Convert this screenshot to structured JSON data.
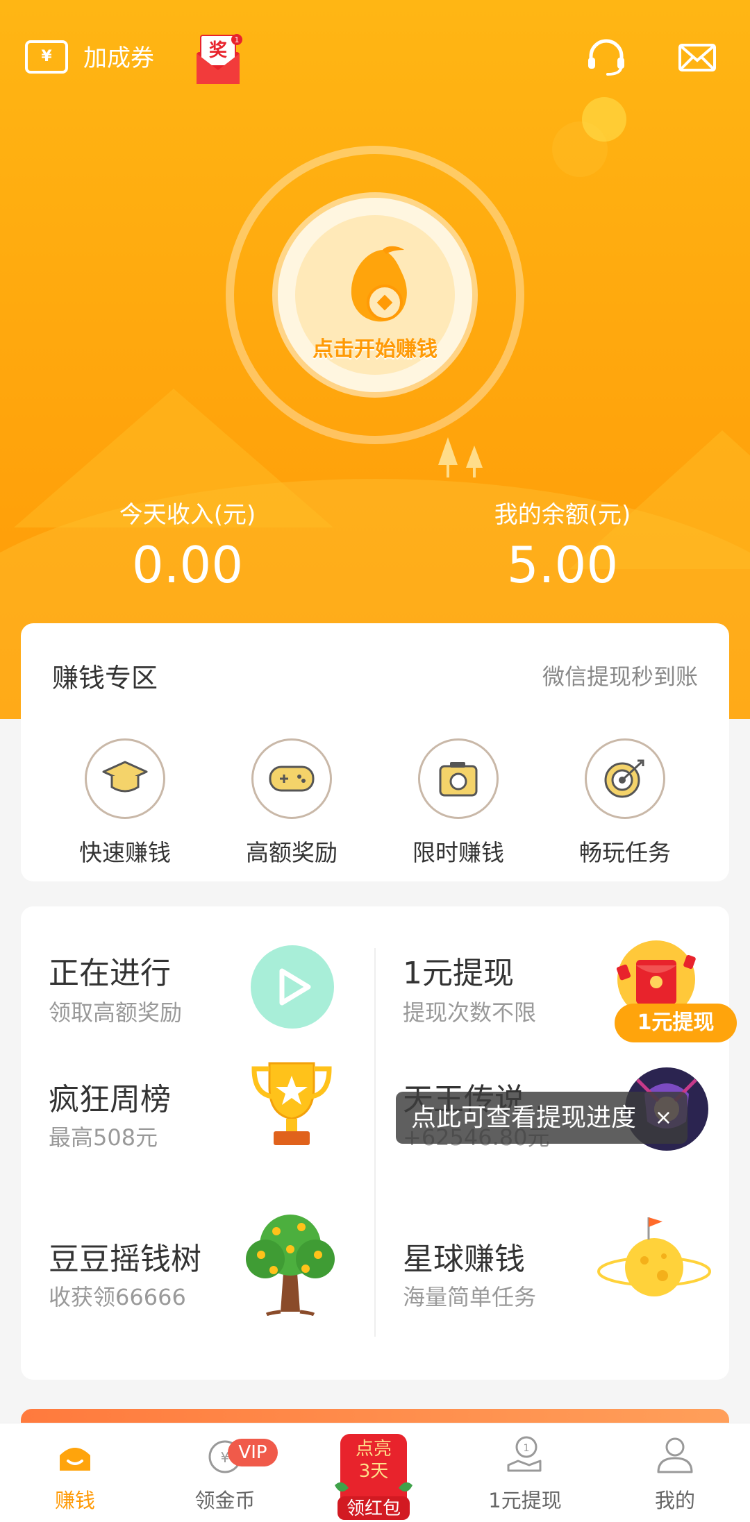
{
  "header": {
    "voucher_icon_text": "¥",
    "voucher_label": "加成券",
    "redpack_char": "奖",
    "redpack_badge": "1",
    "start_button": "点击开始赚钱",
    "today_income_label": "今天收入(元)",
    "today_income_value": "0.00",
    "balance_label": "我的余额(元)",
    "balance_value": "5.00"
  },
  "zone": {
    "title": "赚钱专区",
    "subtitle": "微信提现秒到账",
    "items": [
      {
        "label": "快速赚钱",
        "icon": "graduation-cap-icon"
      },
      {
        "label": "高额奖励",
        "icon": "gamepad-icon"
      },
      {
        "label": "限时赚钱",
        "icon": "camera-icon"
      },
      {
        "label": "畅玩任务",
        "icon": "target-icon"
      }
    ]
  },
  "grid": {
    "items": [
      {
        "title": "正在进行",
        "subtitle": "领取高额奖励",
        "icon": "play-icon"
      },
      {
        "title": "1元提现",
        "subtitle": "提现次数不限",
        "icon": "redpack-icon",
        "badge": "1元提现"
      },
      {
        "title": "疯狂周榜",
        "subtitle": "最高508元",
        "icon": "trophy-icon"
      },
      {
        "title": "天王传说...",
        "subtitle": "+62546.80元",
        "icon": "avatar-icon"
      },
      {
        "title": "豆豆摇钱树",
        "subtitle": "收获领66666",
        "icon": "tree-icon"
      },
      {
        "title": "星球赚钱",
        "subtitle": "海量简单任务",
        "icon": "planet-icon"
      }
    ]
  },
  "tooltip": {
    "text": "点此可查看提现进度",
    "close": "×"
  },
  "nav": {
    "items": [
      {
        "label": "赚钱",
        "icon": "bean-home-icon",
        "active": true
      },
      {
        "label": "领金币",
        "icon": "coin-icon",
        "badge": "VIP"
      },
      {
        "label": "1元提现",
        "icon": "withdraw-icon"
      },
      {
        "label": "我的",
        "icon": "profile-icon"
      }
    ],
    "promo": {
      "line1": "点亮",
      "line2": "3天",
      "line3": "领红包"
    }
  },
  "colors": {
    "brand": "#ffa40c",
    "accent": "#ff9a06",
    "promo": "#e8232c"
  }
}
